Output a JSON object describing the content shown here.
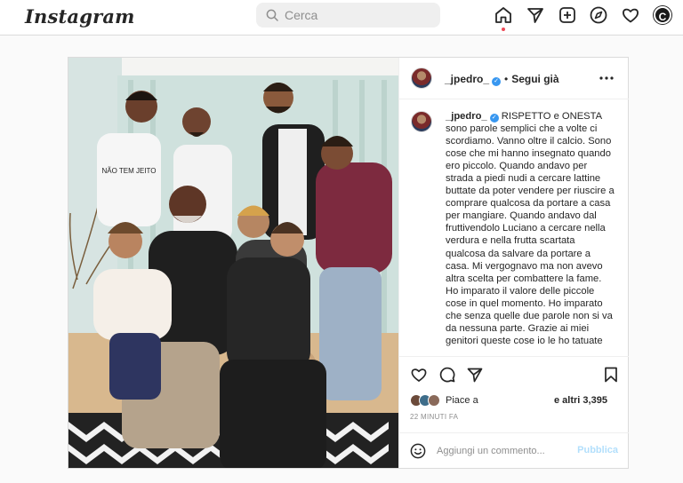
{
  "header": {
    "logo": "Instagram",
    "search_placeholder": "Cerca",
    "nav_icons": [
      "home-icon",
      "direct-icon",
      "new-post-icon",
      "explore-icon",
      "activity-icon",
      "profile-avatar"
    ],
    "profile_initial": "C",
    "notification_color": "#ed4956"
  },
  "post": {
    "username": "_jpedro_",
    "verified": true,
    "separator": "•",
    "follow_status": "Segui già",
    "caption": {
      "username": "_jpedro_",
      "text": "RISPETTO e ONESTA sono parole semplici che a volte ci scordiamo. Vanno oltre il calcio. Sono cose che mi hanno insegnato quando ero piccolo. Quando andavo per strada a piedi nudi a cercare lattine buttate da poter vendere per riuscire a comprare qualcosa da portare a casa per mangiare. Quando andavo dal fruttivendolo Luciano a cercare nella verdura e nella frutta scartata qualcosa da salvare da portare a casa. Mi vergognavo ma non avevo altra scelta per combattere la fame. Ho imparato il valore delle piccole cose in quel momento. Ho imparato che senza quelle due parole non si va da nessuna parte. Grazie ai miei genitori queste cose io le ho tatuate"
    },
    "likes": {
      "label": "Piace a",
      "others": "e altri 3,395"
    },
    "timestamp": "22 MINUTI FA",
    "comment_placeholder": "Aggiungi un commento...",
    "publish_label": "Pubblica",
    "shirt_text": "NÃO TEM JEITO"
  },
  "colors": {
    "verified": "#3897f0",
    "publish_disabled": "#b2dffc",
    "border": "#dbdbdb"
  }
}
